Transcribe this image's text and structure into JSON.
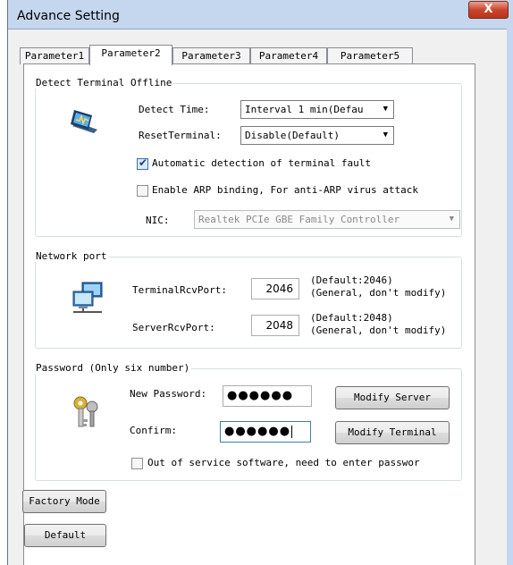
{
  "window": {
    "title": "Advance Setting",
    "close_glyph": "X"
  },
  "tabs": [
    {
      "label": "Parameter1",
      "active": false
    },
    {
      "label": "Parameter2",
      "active": true
    },
    {
      "label": "Parameter3",
      "active": false
    },
    {
      "label": "Parameter4",
      "active": false
    },
    {
      "label": "Parameter5",
      "active": false
    }
  ],
  "detect": {
    "group_label": "Detect Terminal Offline",
    "icon": "terminal-monitor-icon",
    "detect_time_label": "Detect Time:",
    "detect_time_value": "Interval 1 min(Defau",
    "reset_label": "ResetTerminal:",
    "reset_value": "Disable(Default)",
    "auto_detect_label": "Automatic detection of terminal fault",
    "auto_detect_checked": true,
    "arp_label": "Enable ARP binding, For anti-ARP virus attack",
    "arp_checked": false,
    "nic_label": "NIC:",
    "nic_value": "Realtek PCIe GBE Family Controller"
  },
  "network": {
    "group_label": "Network port",
    "icon": "network-computer-icon",
    "terminal_port_label": "TerminalRcvPort:",
    "terminal_port_value": "2046",
    "terminal_port_hint_1": "(Default:2046)",
    "terminal_port_hint_2": "(General, don't modify)",
    "server_port_label": "ServerRcvPort:",
    "server_port_value": "2048",
    "server_port_hint_1": "(Default:2048)",
    "server_port_hint_2": "(General, don't modify)"
  },
  "password": {
    "group_label": "Password (Only six number)",
    "icon": "keys-icon",
    "new_label": "New Password:",
    "new_value": "●●●●●●",
    "confirm_label": "Confirm:",
    "confirm_value": "●●●●●●",
    "modify_server": "Modify Server",
    "modify_terminal": "Modify Terminal",
    "out_of_service_label": "Out of service software, need to enter passwor",
    "out_of_service_checked": false
  },
  "buttons": {
    "factory_mode": "Factory Mode",
    "default": "Default"
  }
}
